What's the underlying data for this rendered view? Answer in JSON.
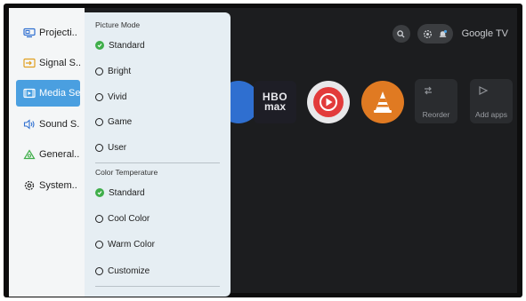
{
  "sidebar": {
    "items": [
      {
        "label": "Projecti..",
        "icon": "projection-icon",
        "active": false
      },
      {
        "label": "Signal S..",
        "icon": "signal-source-icon",
        "active": false
      },
      {
        "label": "Media Se",
        "icon": "media-icon",
        "active": true
      },
      {
        "label": "Sound S..",
        "icon": "speaker-icon",
        "active": false
      },
      {
        "label": "General..",
        "icon": "general-icon",
        "active": false
      },
      {
        "label": "System..",
        "icon": "gear-icon",
        "active": false
      }
    ]
  },
  "picture_mode": {
    "title": "Picture Mode",
    "options": [
      {
        "label": "Standard",
        "selected": true
      },
      {
        "label": "Bright",
        "selected": false
      },
      {
        "label": "Vivid",
        "selected": false
      },
      {
        "label": "Game",
        "selected": false
      },
      {
        "label": "User",
        "selected": false
      }
    ]
  },
  "color_temperature": {
    "title": "Color Temperature",
    "options": [
      {
        "label": "Standard",
        "selected": true
      },
      {
        "label": "Cool Color",
        "selected": false
      },
      {
        "label": "Warm Color",
        "selected": false
      },
      {
        "label": "Customize",
        "selected": false
      }
    ]
  },
  "home": {
    "brand": "Google TV",
    "apps": [
      {
        "name": "HBO Max",
        "text_top": "HBO",
        "text_bottom": "max"
      },
      {
        "name": "YouTube Music"
      },
      {
        "name": "VLC"
      }
    ],
    "tiles": [
      {
        "label": "Reorder",
        "icon": "reorder-icon"
      },
      {
        "label": "Add apps",
        "icon": "add-apps-icon"
      }
    ]
  },
  "colors": {
    "accent": "#4a9fe0",
    "panel_bg": "#e6eef3",
    "check_green": "#3fae4a",
    "screen_bg": "#1c1d1f"
  }
}
